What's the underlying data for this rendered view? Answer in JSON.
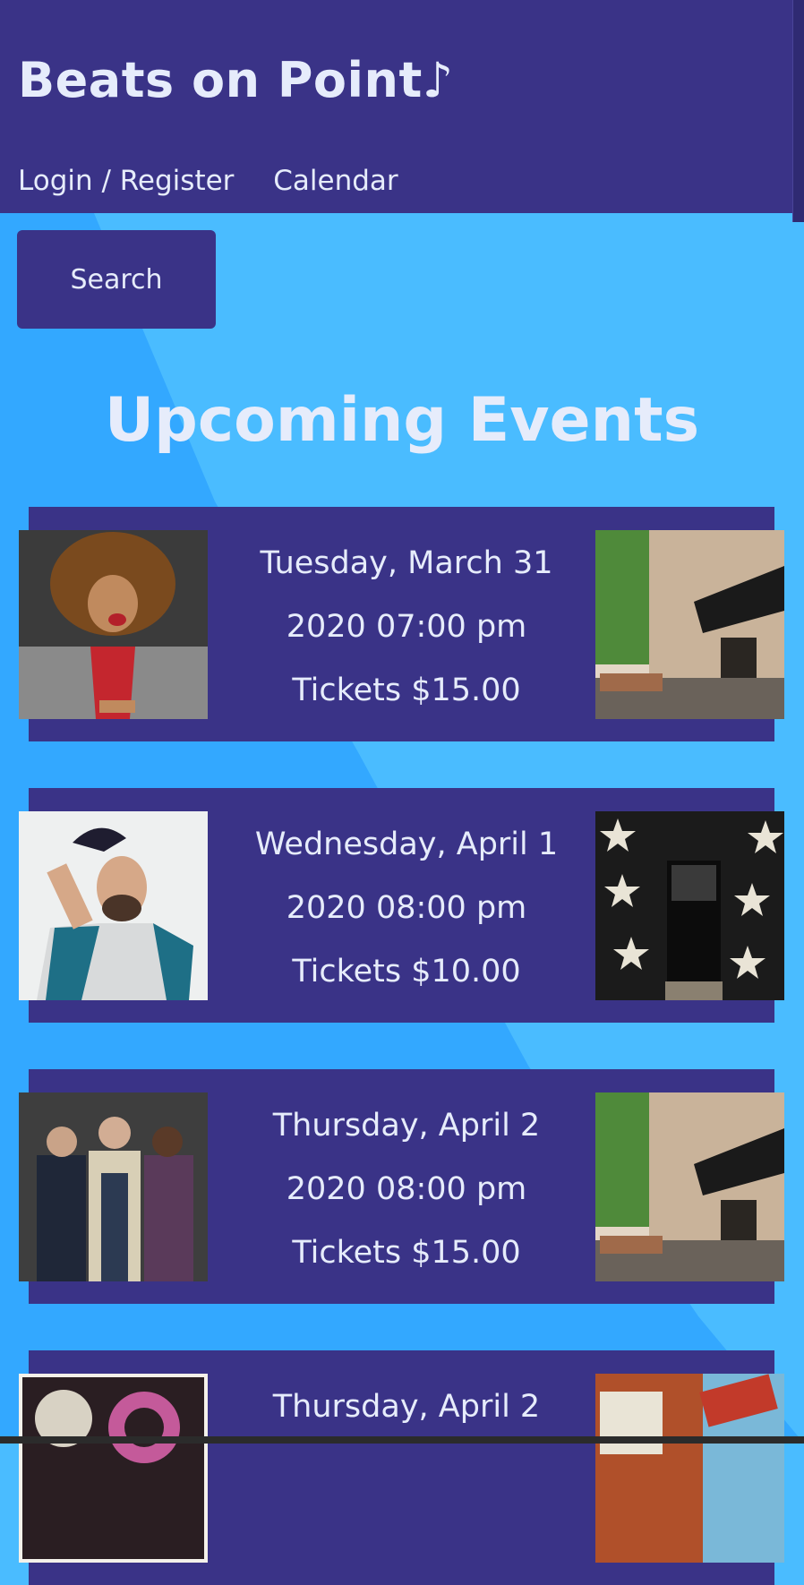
{
  "site": {
    "title": "Beats on Point♪"
  },
  "nav": {
    "items": [
      "Login / Register",
      "Calendar"
    ]
  },
  "search": {
    "label": "Search"
  },
  "heading": "Upcoming Events",
  "events": [
    {
      "day": "Tuesday, March 31",
      "time": "2020 07:00 pm",
      "tickets": "Tickets $15.00",
      "artist_image": "woman-curly-hair-photo",
      "venue_image": "storefront-venue-photo"
    },
    {
      "day": "Wednesday, April 1",
      "time": "2020 08:00 pm",
      "tickets": "Tickets $10.00",
      "artist_image": "man-with-cap-photo",
      "venue_image": "star-wall-venue-photo"
    },
    {
      "day": "Thursday, April 2",
      "time": "2020 08:00 pm",
      "tickets": "Tickets $15.00",
      "artist_image": "three-men-photo",
      "venue_image": "storefront-venue-photo"
    },
    {
      "day": "Thursday, April 2",
      "time": "",
      "tickets": "",
      "artist_image": "poster-art-photo",
      "venue_image": "bar-sign-venue-photo"
    }
  ],
  "colors": {
    "header": "#3a3387",
    "background": "#4abcff",
    "text": "#e6ecfb"
  }
}
